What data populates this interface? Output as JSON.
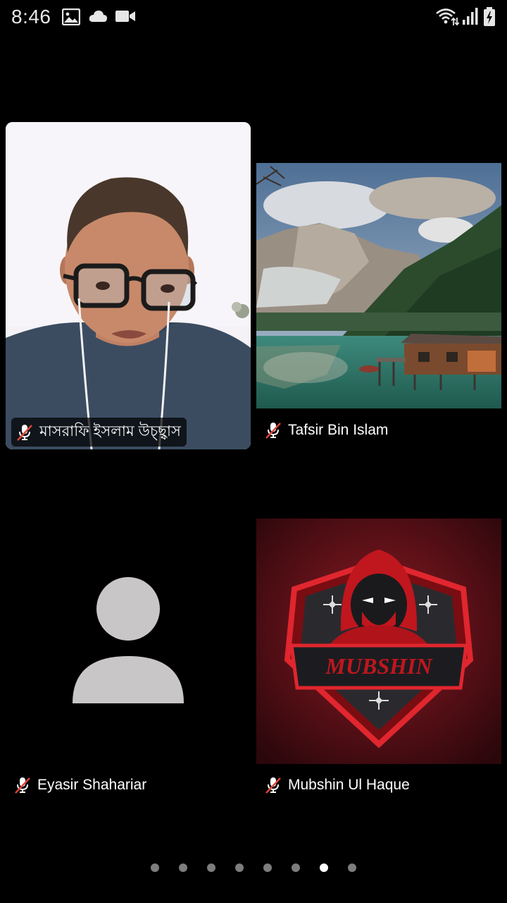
{
  "status_bar": {
    "time": "8:46",
    "left_icons": [
      "image-icon",
      "cloud-icon",
      "video-camera-icon"
    ],
    "right_icons": [
      "wifi-icon",
      "signal-icon",
      "battery-charging-icon"
    ]
  },
  "participants": [
    {
      "name": "মাসরাফি ইসলাম উচ্ছ্বাস",
      "muted": true,
      "view": "camera-video"
    },
    {
      "name": "Tafsir Bin Islam",
      "muted": true,
      "view": "landscape-photo"
    },
    {
      "name": "Eyasir Shahariar",
      "muted": true,
      "view": "default-avatar"
    },
    {
      "name": "Mubshin Ul Haque",
      "muted": true,
      "view": "logo-image",
      "logo_text": "MUBSHIN"
    }
  ],
  "pagination": {
    "total_pages": 8,
    "current_page": 7
  },
  "colors": {
    "background": "#000000",
    "muted_slash": "#e0453a",
    "active_dot": "#ffffff",
    "inactive_dot": "#7d7d7d"
  }
}
